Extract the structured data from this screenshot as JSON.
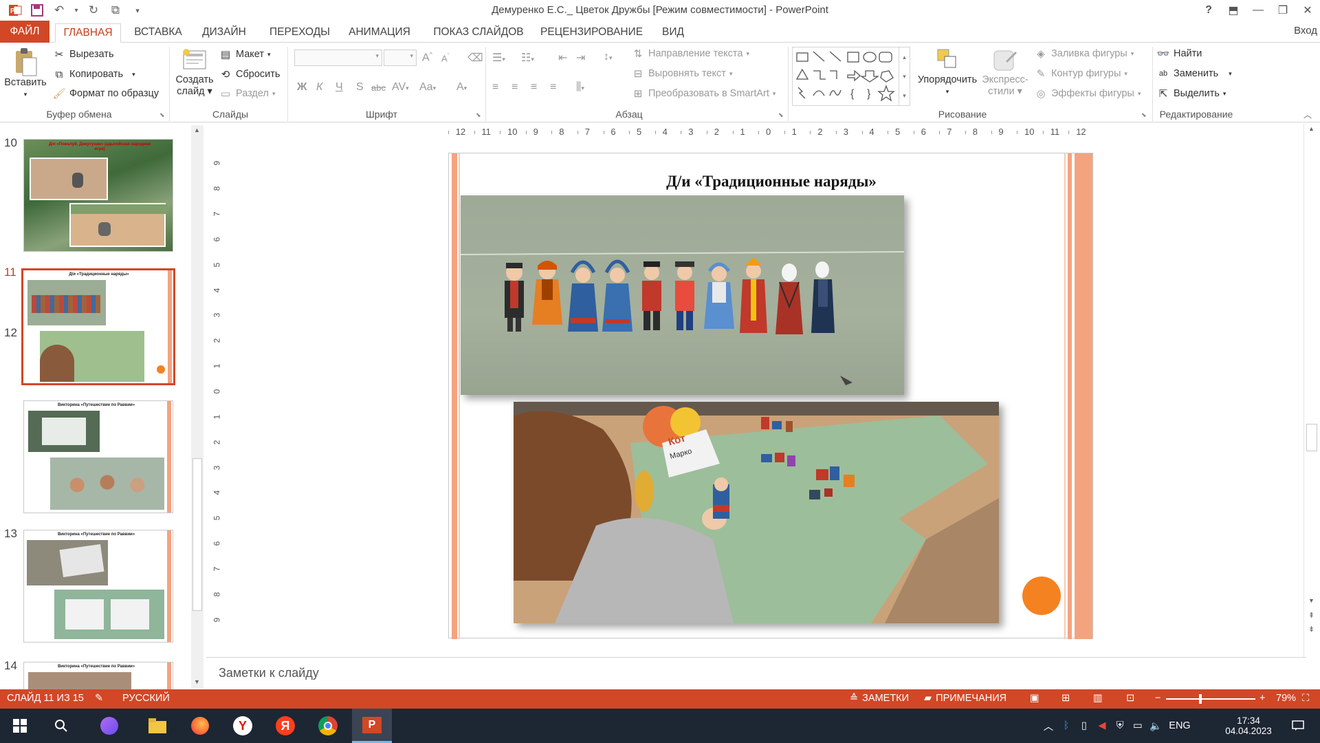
{
  "window": {
    "title": "Демуренко Е.С._ Цветок Дружбы [Режим совместимости] - PowerPoint",
    "help": "?",
    "signin": "Вход"
  },
  "tabs": [
    "ФАЙЛ",
    "ГЛАВНАЯ",
    "ВСТАВКА",
    "ДИЗАЙН",
    "ПЕРЕХОДЫ",
    "АНИМАЦИЯ",
    "ПОКАЗ СЛАЙДОВ",
    "РЕЦЕНЗИРОВАНИЕ",
    "ВИД"
  ],
  "ribbon": {
    "clipboard": {
      "label": "Буфер обмена",
      "paste": "Вставить",
      "cut": "Вырезать",
      "copy": "Копировать",
      "format_painter": "Формат по образцу"
    },
    "slides": {
      "label": "Слайды",
      "new_slide_line1": "Создать",
      "new_slide_line2": "слайд",
      "layout": "Макет",
      "reset": "Сбросить",
      "section": "Раздел"
    },
    "font": {
      "label": "Шрифт",
      "bold": "Ж",
      "italic": "К",
      "underline": "Ч",
      "shadow": "S",
      "strike": "abc",
      "spacing": "AV",
      "case": "Aa",
      "color": "A",
      "grow": "A",
      "shrink": "A"
    },
    "paragraph": {
      "label": "Абзац",
      "text_direction": "Направление текста",
      "align_text": "Выровнять текст",
      "smartart": "Преобразовать в SmartArt"
    },
    "drawing": {
      "label": "Рисование",
      "arrange": "Упорядочить",
      "quick_styles_line1": "Экспресс-",
      "quick_styles_line2": "стили",
      "shape_fill": "Заливка фигуры",
      "shape_outline": "Контур фигуры",
      "shape_effects": "Эффекты фигуры"
    },
    "editing": {
      "label": "Редактирование",
      "find": "Найти",
      "replace": "Заменить",
      "select": "Выделить"
    }
  },
  "thumbnails": [
    {
      "num": "10",
      "title": "Д/и «Пожалуй, Двертунан» (адыгейская народная игра)"
    },
    {
      "num": "11",
      "title": "Д/и «Традиционные наряды»"
    },
    {
      "num": "12",
      "title": "Викторина «Путешествие по Раввии»"
    },
    {
      "num": "13",
      "title": "Викторина «Путешествие по Раввии»"
    },
    {
      "num": "14",
      "title": "Викторина «Путешествие по Раввии»"
    }
  ],
  "ruler_h": [
    "12",
    "11",
    "10",
    "9",
    "8",
    "7",
    "6",
    "5",
    "4",
    "3",
    "2",
    "1",
    "0",
    "1",
    "2",
    "3",
    "4",
    "5",
    "6",
    "7",
    "8",
    "9",
    "10",
    "11",
    "12"
  ],
  "ruler_v": [
    "9",
    "8",
    "7",
    "6",
    "5",
    "4",
    "3",
    "2",
    "1",
    "0",
    "1",
    "2",
    "3",
    "4",
    "5",
    "6",
    "7",
    "8",
    "9"
  ],
  "slide": {
    "title": "Д/и «Традиционные наряды»",
    "bag_text_1": "Кот",
    "bag_text_2": "Марко"
  },
  "notes_placeholder": "Заметки к слайду",
  "status": {
    "slide_info": "СЛАЙД 11 ИЗ 15",
    "language": "РУССКИЙ",
    "notes": "ЗАМЕТКИ",
    "comments": "ПРИМЕЧАНИЯ",
    "zoom": "79%",
    "zoom_value_percent": 79
  },
  "taskbar": {
    "lang": "ENG",
    "time": "17:34",
    "date": "04.04.2023"
  },
  "colors": {
    "accent": "#d24726",
    "slide_orange": "#f4a37f",
    "circle": "#f58220"
  }
}
